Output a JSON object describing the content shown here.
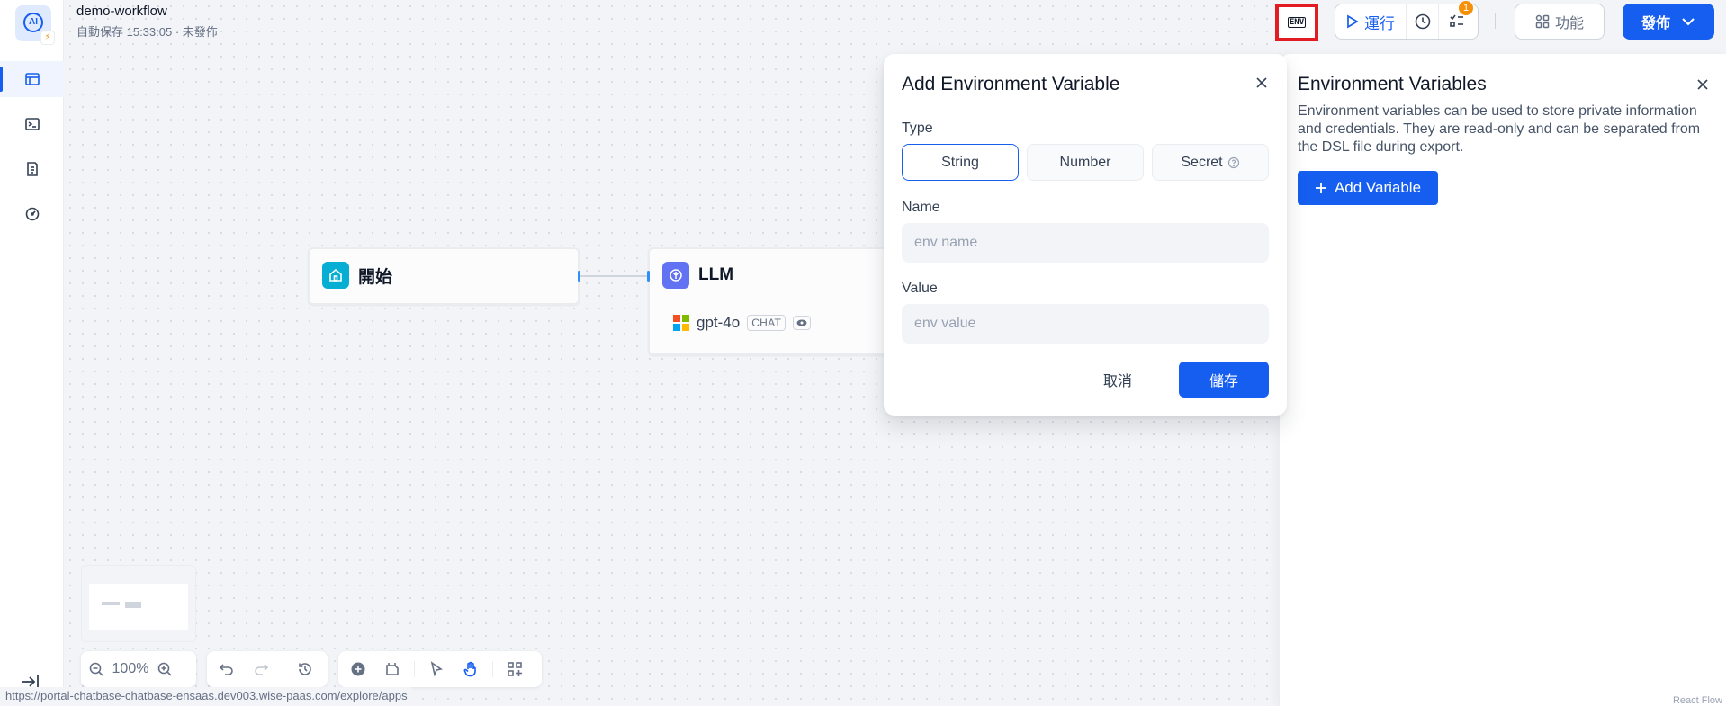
{
  "header": {
    "app_name": "demo-workflow",
    "status": "自動保存 15:33:05 · 未發佈",
    "env_icon_label": "ENV",
    "run_label": "運行",
    "checklist_count": "1",
    "features_label": "功能",
    "publish_label": "發佈"
  },
  "sidebar": {
    "items": [
      {
        "icon": "workflow-icon"
      },
      {
        "icon": "terminal-icon"
      },
      {
        "icon": "logs-icon"
      },
      {
        "icon": "monitor-icon"
      }
    ]
  },
  "nodes": {
    "start": {
      "title": "開始"
    },
    "llm": {
      "title": "LLM",
      "model": "gpt-4o",
      "mode": "CHAT"
    }
  },
  "toolbar": {
    "zoom": "100%"
  },
  "status_bar": {
    "url": "https://portal-chatbase-chatbase-ensaas.dev003.wise-paas.com/explore/apps"
  },
  "dialog": {
    "title": "Add Environment Variable",
    "type_label": "Type",
    "types": [
      "String",
      "Number",
      "Secret"
    ],
    "selected_type": "String",
    "name_label": "Name",
    "name_placeholder": "env name",
    "name_value": "",
    "value_label": "Value",
    "value_placeholder": "env value",
    "value_value": "",
    "cancel_label": "取消",
    "save_label": "儲存"
  },
  "panel": {
    "title": "Environment Variables",
    "description": "Environment variables can be used to store private information and credentials. They are read-only and can be separated from the DSL file during export.",
    "add_label": "Add Variable",
    "footer": "React Flow"
  },
  "colors": {
    "accent": "#155eef",
    "highlight": "#e31b23",
    "start_node": "#06aed4",
    "llm_node": "#6172f3",
    "badge": "#f79009"
  }
}
